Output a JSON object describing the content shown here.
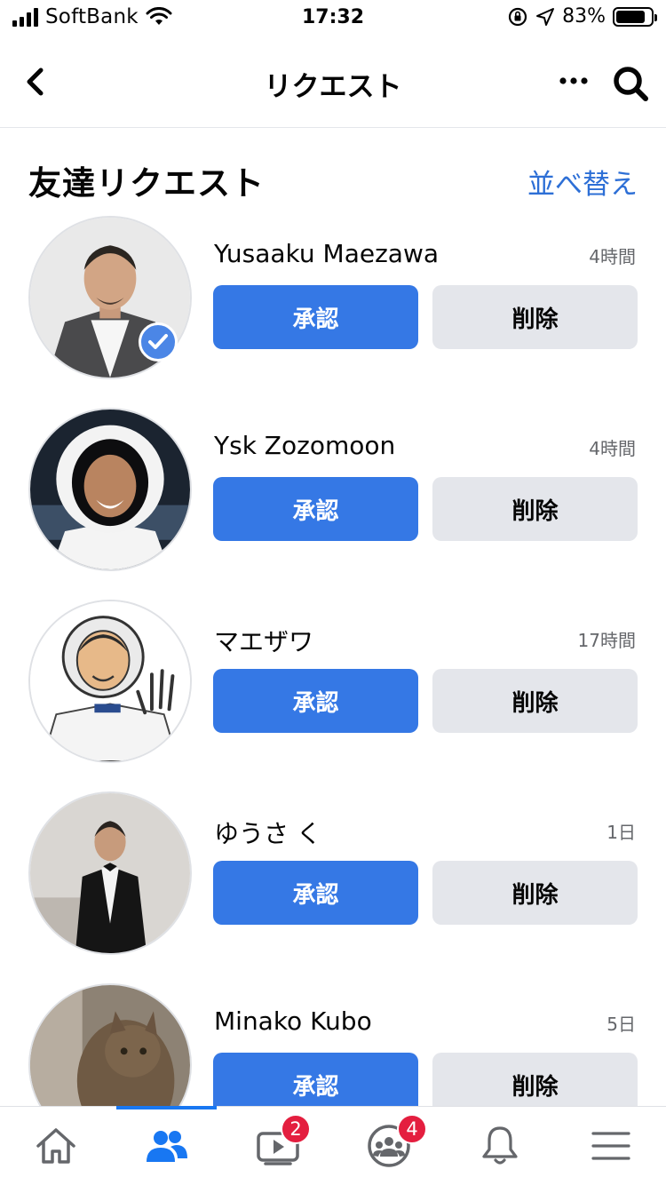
{
  "status_bar": {
    "carrier": "SoftBank",
    "time": "17:32",
    "battery_text": "83%",
    "battery_level": 0.83
  },
  "header": {
    "title": "リクエスト",
    "back_icon": "chevron-left-icon",
    "more_icon": "ellipsis-icon",
    "search_icon": "search-icon"
  },
  "section": {
    "title": "友達リクエスト",
    "sort_label": "並べ替え"
  },
  "requests": [
    {
      "name": "Yusaaku Maezawa",
      "time": "4時間",
      "confirm_label": "承認",
      "delete_label": "削除",
      "verified": true
    },
    {
      "name": "Ysk Zozomoon",
      "time": "4時間",
      "confirm_label": "承認",
      "delete_label": "削除",
      "verified": false
    },
    {
      "name": "マエザワ",
      "time": "17時間",
      "confirm_label": "承認",
      "delete_label": "削除",
      "verified": false
    },
    {
      "name": "ゆうさ く",
      "time": "1日",
      "confirm_label": "承認",
      "delete_label": "削除",
      "verified": false
    },
    {
      "name": "Minako Kubo",
      "time": "5日",
      "confirm_label": "承認",
      "delete_label": "削除",
      "verified": false
    }
  ],
  "tab_bar": {
    "tabs": [
      {
        "icon": "home-icon",
        "badge": ""
      },
      {
        "icon": "friends-icon",
        "badge": "",
        "active": true
      },
      {
        "icon": "watch-icon",
        "badge": "2"
      },
      {
        "icon": "groups-icon",
        "badge": "4"
      },
      {
        "icon": "bell-icon",
        "badge": ""
      },
      {
        "icon": "menu-icon",
        "badge": ""
      }
    ]
  },
  "colors": {
    "accent": "#3578e5",
    "link": "#2d6fd6",
    "badge": "#e41e3f",
    "secondary_button": "#e4e6eb"
  }
}
